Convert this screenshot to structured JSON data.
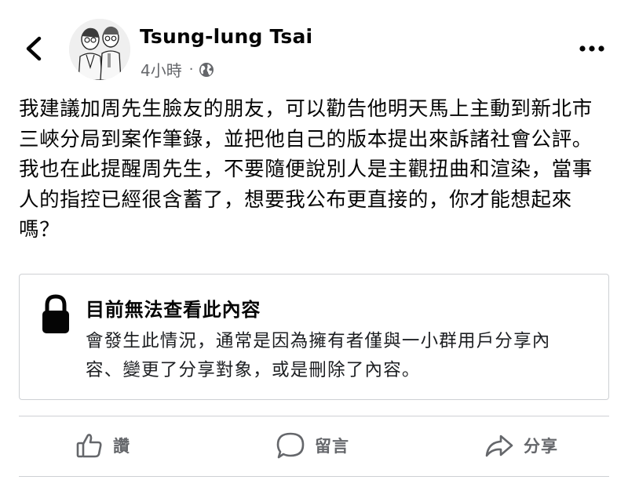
{
  "header": {
    "author_name": "Tsung-lung Tsai",
    "timestamp": "4小時",
    "separator": "·",
    "audience_icon": "globe-icon",
    "back_icon": "chevron-left-icon",
    "more_icon": "more-horizontal-icon"
  },
  "post": {
    "paragraphs": [
      "我建議加周先生臉友的朋友，可以勸告他明天馬上主動到新北市三峽分局到案作筆錄，並把他自己的版本提出來訴諸社會公評。",
      "我也在此提醒周先生，不要隨便說別人是主觀扭曲和渲染，當事人的指控已經很含蓄了，想要我公布更直接的，你才能想起來嗎？"
    ]
  },
  "unavailable_card": {
    "icon": "lock-icon",
    "title": "目前無法查看此內容",
    "body": "會發生此情況，通常是因為擁有者僅與一小群用戶分享內容、變更了分享對象，或是刪除了內容。"
  },
  "actions": {
    "like_label": "讚",
    "comment_label": "留言",
    "share_label": "分享"
  },
  "colors": {
    "text_primary": "#050505",
    "text_secondary": "#65676b",
    "divider": "#ced0d4"
  }
}
